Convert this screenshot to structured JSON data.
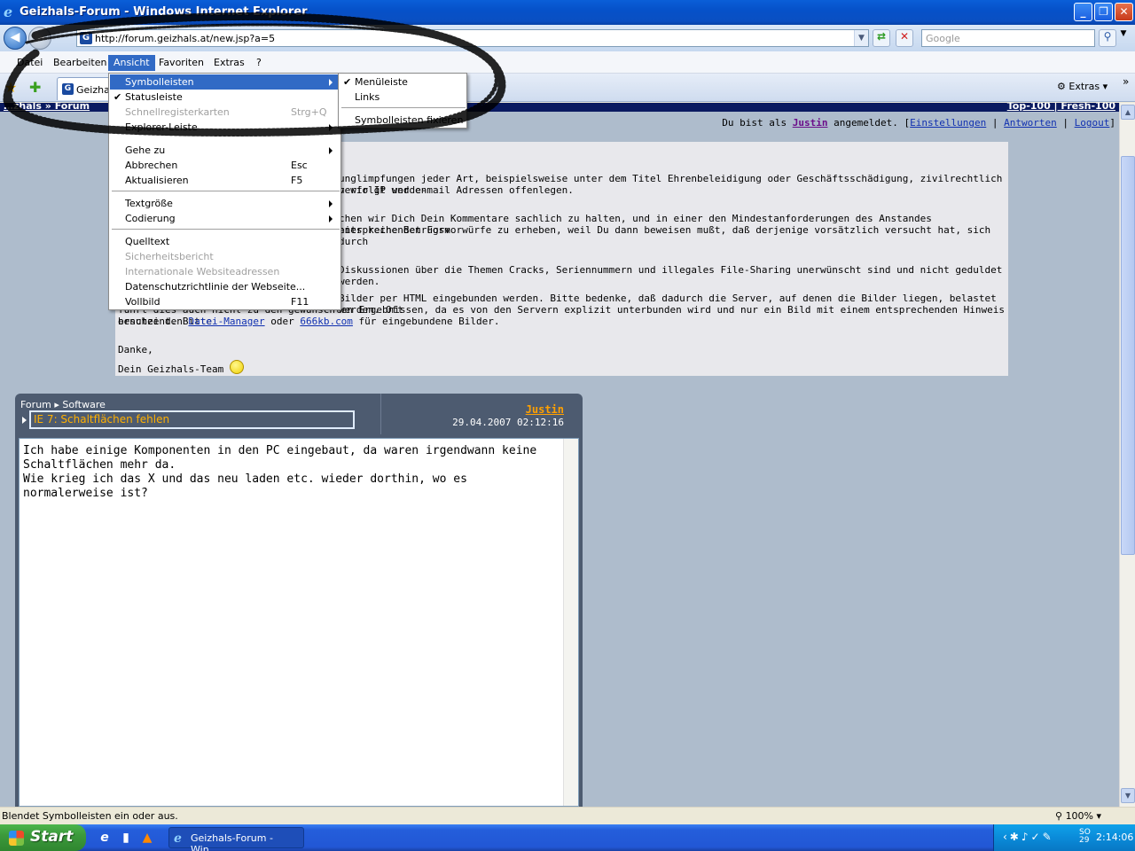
{
  "window": {
    "title": "Geizhals-Forum - Windows Internet Explorer",
    "buttons": {
      "minimize": "_",
      "maximize": "❐",
      "close": "✕"
    }
  },
  "address_bar": {
    "url": "http://forum.geizhals.at/new.jsp?a=5",
    "search_placeholder": "Google"
  },
  "menubar": {
    "items": [
      "Datei",
      "Bearbeiten",
      "Ansicht",
      "Favoriten",
      "Extras",
      "?"
    ],
    "active": "Ansicht"
  },
  "tabbar": {
    "tab_label": "Geizhal",
    "extras_label": "Extras",
    "chevron": "»"
  },
  "page": {
    "topnav_left": "…zhals » Forum",
    "topnav_right": "Top-100 | Fresh-100",
    "login": {
      "prefix": "Du bist als ",
      "user": "Justin",
      "middle": " angemeldet. [",
      "links": [
        "Einstellungen",
        "Antworten",
        "Logout"
      ],
      "suffix": "]"
    },
    "notice": {
      "p1_line1": "unglimpfungen jeder Art, beispielsweise unter dem Titel Ehrenbeleidigung oder Geschäftsschädigung, zivilrechtlich verfolgt werden",
      "p1_line2": "n wir IP und e-mail Adressen offenlegen.",
      "p2_line1": "chen wir Dich Dein Kommentare sachlich zu halten, und in einer den Mindestanforderungen des Anstandes entsprechenden Form",
      "p2_line2": "hier keine Betrugsvorwürfe zu erheben, weil Du dann beweisen mußt, daß derjenige vorsätzlich versucht hat, sich durch",
      "p3": "Diskussionen über die Themen Cracks, Seriennummern und illegales File-Sharing unerwünscht sind und nicht geduldet werden.",
      "p4_line1": "Bilder per HTML eingebunden werden. Bitte bedenke, daß dadurch die Server, auf denen die Bilder liegen, belastet werden. Oft",
      "p4_line2": "führt dies auch nicht zu den gewünschten Ergebnissen, da es von den Servern explizit unterbunden wird und nur ein Bild mit einem entsprechenden Hinweis erscheint. Bitte",
      "p4_line3_prefix": "benutze den ",
      "p4_link1": "Datei-Manager",
      "p4_mid": " oder ",
      "p4_link2": "666kb.com",
      "p4_suffix": " für eingebundene Bilder.",
      "thanks": "Danke,",
      "signature": "Dein Geizhals-Team"
    },
    "post": {
      "breadcrumb": "Forum ▸ Software",
      "subject": "IE 7: Schaltflächen fehlen",
      "author": "Justin",
      "date": "29.04.2007 02:12:16",
      "body": "Ich habe einige Komponenten in den PC eingebaut, da waren irgendwann keine\nSchaltflächen mehr da.\nWie krieg ich das X und das neu laden etc. wieder dorthin, wo es normalerweise ist?"
    }
  },
  "menu_ansicht": {
    "items": [
      {
        "label": "Symbolleisten",
        "submenu": true,
        "highlighted": true
      },
      {
        "label": "Statusleiste",
        "checked": true
      },
      {
        "label": "Schnellregisterkarten",
        "shortcut": "Strg+Q",
        "disabled": true
      },
      {
        "label": "Explorer-Leiste",
        "submenu": true
      },
      {
        "label": "Gehe zu",
        "submenu": true
      },
      {
        "label": "Abbrechen",
        "shortcut": "Esc"
      },
      {
        "label": "Aktualisieren",
        "shortcut": "F5"
      },
      {
        "label": "Textgröße",
        "submenu": true
      },
      {
        "label": "Codierung",
        "submenu": true
      },
      {
        "label": "Quelltext"
      },
      {
        "label": "Sicherheitsbericht",
        "disabled": true
      },
      {
        "label": "Internationale Websiteadressen",
        "disabled": true
      },
      {
        "label": "Datenschutzrichtlinie der Webseite..."
      },
      {
        "label": "Vollbild",
        "shortcut": "F11"
      }
    ]
  },
  "menu_symbolleisten": {
    "items": [
      {
        "label": "Menüleiste",
        "checked": true
      },
      {
        "label": "Links"
      },
      {
        "label": "Symbolleisten fixieren"
      }
    ]
  },
  "statusbar": {
    "text": "Blendet Symbolleisten ein oder aus.",
    "zoom": "100%"
  },
  "taskbar": {
    "start_label": "Start",
    "task_button": "Geizhals-Forum - Win...",
    "tray_day": "SO",
    "tray_date": "29",
    "time": "2:14:06"
  }
}
